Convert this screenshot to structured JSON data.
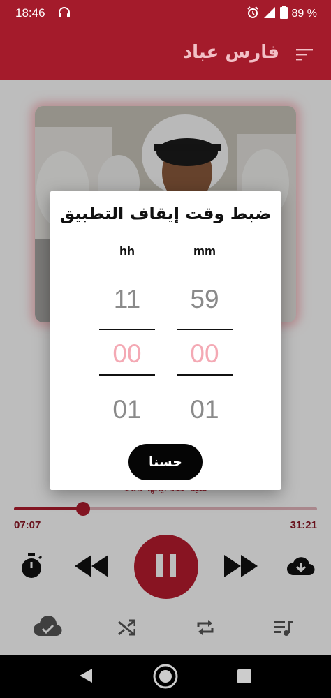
{
  "status_bar": {
    "time": "18:46",
    "battery": "89 %",
    "icons": [
      "headphones-icon",
      "alarm-icon",
      "signal-icon",
      "battery-icon"
    ]
  },
  "app_bar": {
    "title": "فارس عباد",
    "menu_icon": "sort-menu-icon"
  },
  "player": {
    "track_subtitle": "سيه عدد اياتها 109",
    "elapsed": "07:07",
    "total": "31:21",
    "progress": 0.227,
    "controls": [
      "sleep-timer-icon",
      "rewind-icon",
      "pause-icon",
      "fast-forward-icon",
      "download-icon"
    ],
    "bottom_icons": [
      "cloud-check-icon",
      "shuffle-icon",
      "repeat-icon",
      "playlist-icon"
    ]
  },
  "dialog": {
    "title": "ضبط وقت إيقاف التطبيق",
    "hours_label": "hh",
    "minutes_label": "mm",
    "hours": {
      "prev": "11",
      "selected": "00",
      "next": "01"
    },
    "minutes": {
      "prev": "59",
      "selected": "00",
      "next": "01"
    },
    "ok_label": "حسنا"
  },
  "colors": {
    "brand": "#a41b2b",
    "accent": "#b81c2f",
    "selected_number": "#f4a9b4"
  }
}
